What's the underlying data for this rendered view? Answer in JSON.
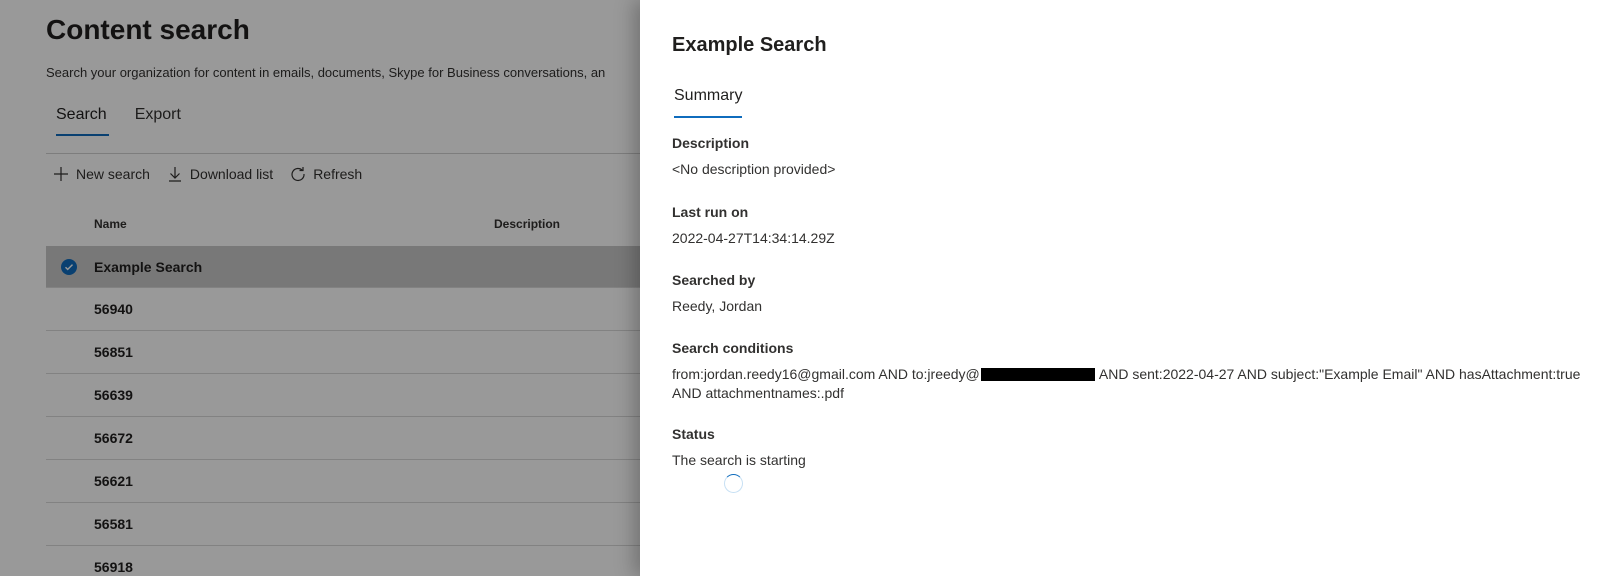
{
  "page": {
    "title": "Content search",
    "subtitle": "Search your organization for content in emails, documents, Skype for Business conversations, an",
    "tabs": [
      "Search",
      "Export"
    ],
    "toolbar": {
      "new_search": "New search",
      "download_list": "Download list",
      "refresh": "Refresh"
    },
    "columns": {
      "name": "Name",
      "description": "Description"
    },
    "rows": [
      "Example Search",
      "56940",
      "56851",
      "56639",
      "56672",
      "56621",
      "56581",
      "56918"
    ]
  },
  "panel": {
    "title": "Example Search",
    "tab": "Summary",
    "description": {
      "label": "Description",
      "value": "<No description provided>"
    },
    "last_run": {
      "label": "Last run on",
      "value": "2022-04-27T14:34:14.29Z"
    },
    "searched_by": {
      "label": "Searched by",
      "value": "Reedy, Jordan"
    },
    "conditions": {
      "label": "Search conditions",
      "before_redaction": "from:jordan.reedy16@gmail.com AND to:jreedy@",
      "after_redaction": " AND sent:2022-04-27 AND subject:\"Example Email\" AND hasAttachment:true AND attachmentnames:.pdf"
    },
    "status": {
      "label": "Status",
      "value": "The search is starting"
    }
  },
  "colors": {
    "accent": "#0f6cbd",
    "overlay": "rgba(0,0,0,0.40)"
  },
  "icons": {
    "new_search": "plus-icon",
    "download_list": "download-icon",
    "refresh": "refresh-icon",
    "row_selected": "checkmark-circle-icon",
    "status": "loading-spinner-icon"
  }
}
